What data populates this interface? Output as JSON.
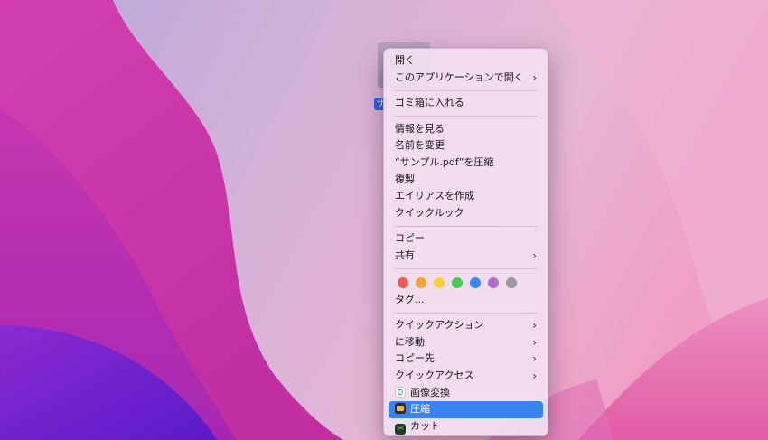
{
  "file_label": "サ",
  "menu": {
    "group1": [
      {
        "label": "開く",
        "submenu": false
      },
      {
        "label": "このアプリケーションで開く",
        "submenu": true
      }
    ],
    "group2": [
      {
        "label": "ゴミ箱に入れる",
        "submenu": false
      }
    ],
    "group3": [
      {
        "label": "情報を見る",
        "submenu": false
      },
      {
        "label": "名前を変更",
        "submenu": false
      },
      {
        "label": "“サンプル.pdf”を圧縮",
        "submenu": false
      },
      {
        "label": "複製",
        "submenu": false
      },
      {
        "label": "エイリアスを作成",
        "submenu": false
      },
      {
        "label": "クイックルック",
        "submenu": false
      }
    ],
    "group4": [
      {
        "label": "コピー",
        "submenu": false
      },
      {
        "label": "共有",
        "submenu": true
      }
    ],
    "tags": {
      "colors": [
        "#ef5a51",
        "#f3a33a",
        "#f6cf3a",
        "#48c95a",
        "#3c87f0",
        "#b06dd6",
        "#9b9a9d"
      ],
      "color_names": [
        "red-tag",
        "orange-tag",
        "yellow-tag",
        "green-tag",
        "blue-tag",
        "purple-tag",
        "gray-tag"
      ],
      "label": "タグ..."
    },
    "group5": [
      {
        "label": "クイックアクション",
        "submenu": true
      },
      {
        "label": "に移動",
        "submenu": true
      },
      {
        "label": "コピー先",
        "submenu": true
      },
      {
        "label": "クイックアクセス",
        "submenu": true
      }
    ],
    "group6": [
      {
        "label": "画像変換",
        "icon": "image-convert-icon"
      },
      {
        "label": "圧縮",
        "icon": "compress-app-icon",
        "selected": true
      },
      {
        "label": "カット",
        "icon": "cut-app-icon"
      }
    ],
    "chevron_glyph": "›"
  },
  "colors": {
    "selection": "#3b82f0",
    "menu_bg": "#f2e0f0"
  }
}
